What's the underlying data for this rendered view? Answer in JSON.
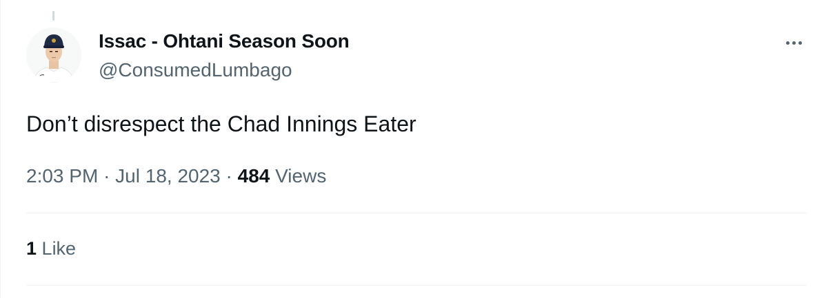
{
  "author": {
    "display_name": "Issac - Ohtani Season Soon",
    "handle": "@ConsumedLumbago",
    "avatar_icon": "baseball-player-avatar"
  },
  "tweet": {
    "text": "Don’t disrespect the Chad Innings Eater",
    "time": "2:03 PM",
    "separator": "·",
    "date": "Jul 18, 2023",
    "views_count": "484",
    "views_label": "Views"
  },
  "engagement": {
    "likes_count": "1",
    "likes_label": "Like"
  },
  "icons": {
    "more": "more-options-icon"
  },
  "colors": {
    "primary_text": "#0f1419",
    "secondary_text": "#536471",
    "divider": "#eff3f4",
    "cap": "#1f2a44"
  }
}
